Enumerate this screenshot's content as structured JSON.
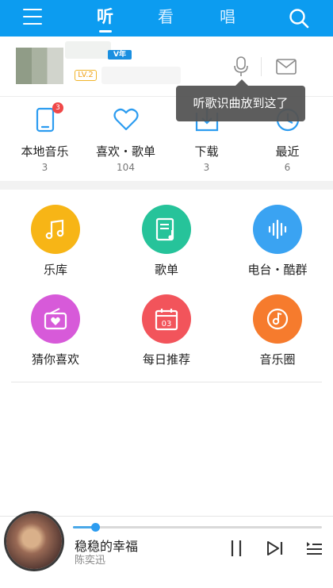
{
  "header": {
    "tabs": [
      "听",
      "看",
      "唱"
    ],
    "active_tab": "听"
  },
  "profile": {
    "vip_label": "V年",
    "level": "LV.2"
  },
  "tooltip": "听歌识曲放到这了",
  "quick_actions": [
    {
      "label": "本地音乐",
      "count": "3",
      "icon": "phone-icon",
      "badge": "3"
    },
    {
      "label": "喜欢・歌单",
      "count": "104",
      "icon": "heart-icon"
    },
    {
      "label": "下载",
      "count": "3",
      "icon": "download-icon"
    },
    {
      "label": "最近",
      "count": "6",
      "icon": "clock-icon"
    }
  ],
  "features": [
    {
      "label": "乐库",
      "icon": "music-note-icon",
      "color": "#f7b516"
    },
    {
      "label": "歌单",
      "icon": "playlist-icon",
      "color": "#26c39a"
    },
    {
      "label": "电台・酷群",
      "icon": "soundwave-icon",
      "color": "#3aa3f2"
    },
    {
      "label": "猜你喜欢",
      "icon": "radio-heart-icon",
      "color": "#d75ad9"
    },
    {
      "label": "每日推荐",
      "icon": "calendar-icon",
      "color": "#f2545b"
    },
    {
      "label": "音乐圈",
      "icon": "disc-note-icon",
      "color": "#f67b2d"
    }
  ],
  "calendar_day": "03",
  "player": {
    "title": "稳稳的幸福",
    "artist": "陈奕迅",
    "progress": 0.09
  },
  "colors": {
    "brand": "#0c9cf0"
  }
}
